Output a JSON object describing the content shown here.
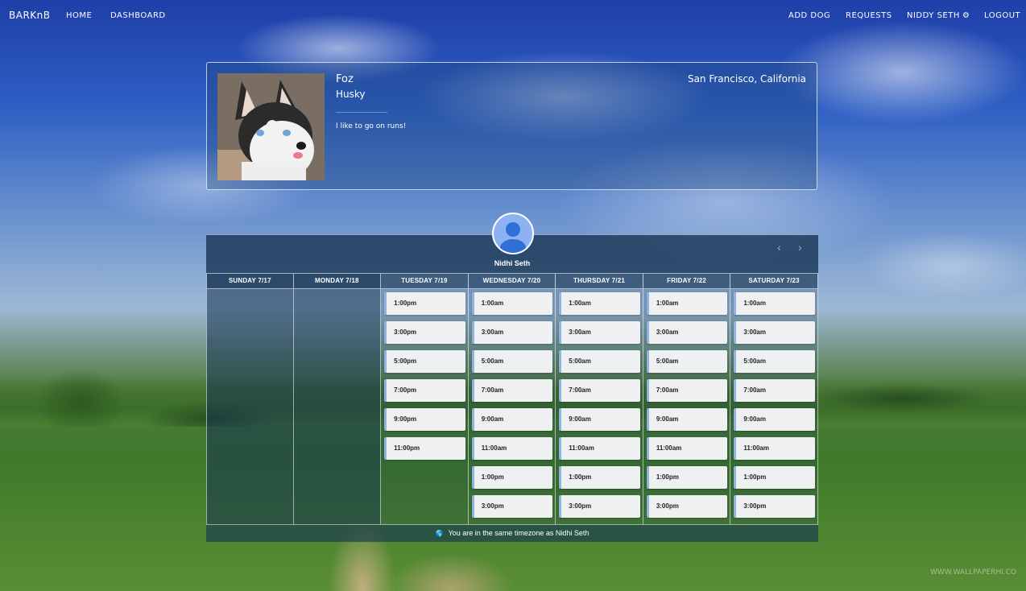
{
  "nav": {
    "brand": "BARKnB",
    "left_links": [
      "HOME",
      "DASHBOARD"
    ],
    "add_dog": "ADD DOG",
    "requests": "REQUESTS",
    "user": "NIDDY SETH",
    "gear_icon": "gear-icon",
    "logout": "LOGOUT"
  },
  "dog": {
    "name": "Foz",
    "breed": "Husky",
    "bio": "I like to go on runs!",
    "location": "San Francisco, California"
  },
  "calendar": {
    "host_name": "Nidhi Seth",
    "prev_icon": "chevron-left-icon",
    "next_icon": "chevron-right-icon",
    "days": [
      {
        "label": "SUNDAY 7/17",
        "slots": []
      },
      {
        "label": "MONDAY 7/18",
        "slots": []
      },
      {
        "label": "TUESDAY 7/19",
        "slots": [
          "1:00pm",
          "3:00pm",
          "5:00pm",
          "7:00pm",
          "9:00pm",
          "11:00pm"
        ]
      },
      {
        "label": "WEDNESDAY 7/20",
        "slots": [
          "1:00am",
          "3:00am",
          "5:00am",
          "7:00am",
          "9:00am",
          "11:00am",
          "1:00pm",
          "3:00pm"
        ]
      },
      {
        "label": "THURSDAY 7/21",
        "slots": [
          "1:00am",
          "3:00am",
          "5:00am",
          "7:00am",
          "9:00am",
          "11:00am",
          "1:00pm",
          "3:00pm"
        ]
      },
      {
        "label": "FRIDAY 7/22",
        "slots": [
          "1:00am",
          "3:00am",
          "5:00am",
          "7:00am",
          "9:00am",
          "11:00am",
          "1:00pm",
          "3:00pm"
        ]
      },
      {
        "label": "SATURDAY 7/23",
        "slots": [
          "1:00am",
          "3:00am",
          "5:00am",
          "7:00am",
          "9:00am",
          "11:00am",
          "1:00pm",
          "3:00pm"
        ]
      }
    ],
    "timezone_note": "You are in the same timezone as Nidhi Seth"
  },
  "watermark": "WWW.WALLPAPERHI.CO"
}
